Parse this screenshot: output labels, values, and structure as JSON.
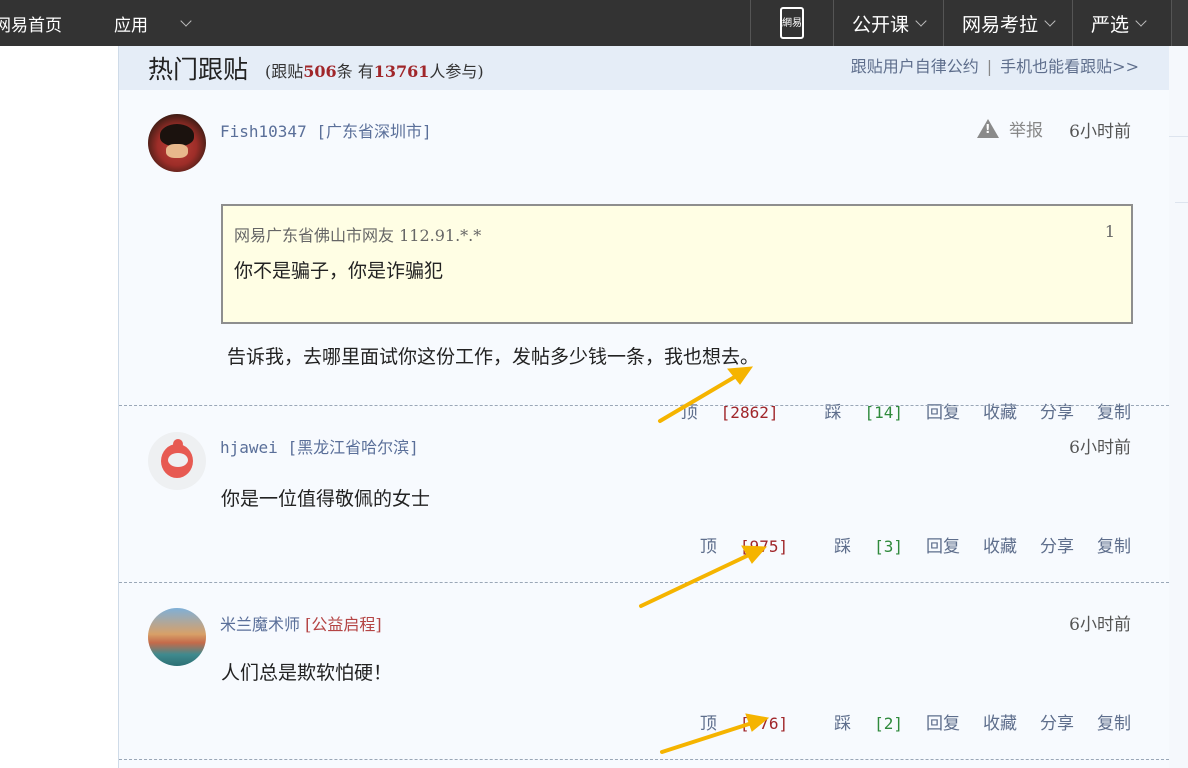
{
  "topbar": {
    "home_label": "网易首页",
    "apps_label": "应用",
    "phone_label": "網易",
    "course_label": "公开课",
    "kaola_label": "网易考拉",
    "yanxuan_label": "严选"
  },
  "panel": {
    "title": "热门跟贴",
    "sub_prefix": "(跟贴",
    "posts_count": "506",
    "sub_mid": "条 有",
    "people_count": "13761",
    "sub_suffix": "人参与)",
    "link_rules": "跟贴用户自律公约",
    "link_sep": "|",
    "link_mobile": "手机也能看跟贴>>"
  },
  "comments": [
    {
      "user": "Fish10347",
      "location": "[广东省深圳市]",
      "report_label": "举报",
      "time": "6小时前",
      "quote_author": "网易广东省佛山市网友 112.91.*.*",
      "quote_floor": "1",
      "quote_text": "你不是骗子，你是诈骗犯",
      "text": "告诉我，去哪里面试你这份工作，发帖多少钱一条，我也想去。",
      "up_label": "顶",
      "up_count": "[2862]",
      "down_label": "踩",
      "down_count": "[14]",
      "reply_label": "回复",
      "fav_label": "收藏",
      "share_label": "分享",
      "copy_label": "复制"
    },
    {
      "user": "hjawei",
      "location": "[黑龙江省哈尔滨]",
      "time": "6小时前",
      "text": "你是一位值得敬佩的女士",
      "up_label": "顶",
      "up_count": "[975]",
      "down_label": "踩",
      "down_count": "[3]",
      "reply_label": "回复",
      "fav_label": "收藏",
      "share_label": "分享",
      "copy_label": "复制"
    },
    {
      "user": "米兰魔术师",
      "location": "[公益启程]",
      "time": "6小时前",
      "text": "人们总是欺软怕硬！",
      "up_label": "顶",
      "up_count": "[776]",
      "down_label": "踩",
      "down_count": "[2]",
      "reply_label": "回复",
      "fav_label": "收藏",
      "share_label": "分享",
      "copy_label": "复制"
    }
  ],
  "colors": {
    "topbar": "#333333",
    "accent_red": "#a0262a",
    "accent_green": "#2f8a3c",
    "link_blue": "#5e6e8c",
    "annotation_arrow": "#f5b400"
  }
}
